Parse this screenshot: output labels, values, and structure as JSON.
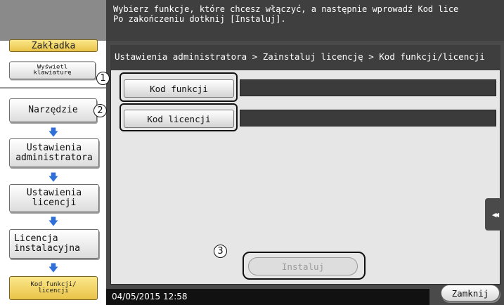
{
  "header": {
    "message": "Wybierz funkcje, które chcesz włączyć, a następnie wprowadź Kod lice\nPo zakończeniu dotknij [Instaluj]."
  },
  "sidebar": {
    "tab_label": "Zakładka",
    "view_keyboard_label": "Wyświetl\nklawiaturę",
    "items": [
      {
        "label": "Narzędzie"
      },
      {
        "label": "Ustawienia\nadministratora"
      },
      {
        "label": "Ustawienia\nlicencji"
      },
      {
        "label": "Licencja\ninstalacyjna"
      }
    ],
    "current_label": "Kod funkcji/\nlicencji",
    "arrow_glyph": "🡇"
  },
  "breadcrumb": "Ustawienia administratora > Zainstaluj licencję > Kod funkcji/licencji",
  "main": {
    "function_code_label": "Kod funkcji",
    "license_code_label": "Kod licencji",
    "install_label": "Instaluj"
  },
  "callouts": [
    "1",
    "2",
    "3"
  ],
  "status": {
    "datetime": "04/05/2015  12:58"
  },
  "close_label": "Zamknij",
  "scroll_glyph": "◀◀",
  "colors": {
    "accent_blue": "#2f6fd8",
    "tab_gold": "#e9c349",
    "dark_frame": "#4a4a4a"
  }
}
